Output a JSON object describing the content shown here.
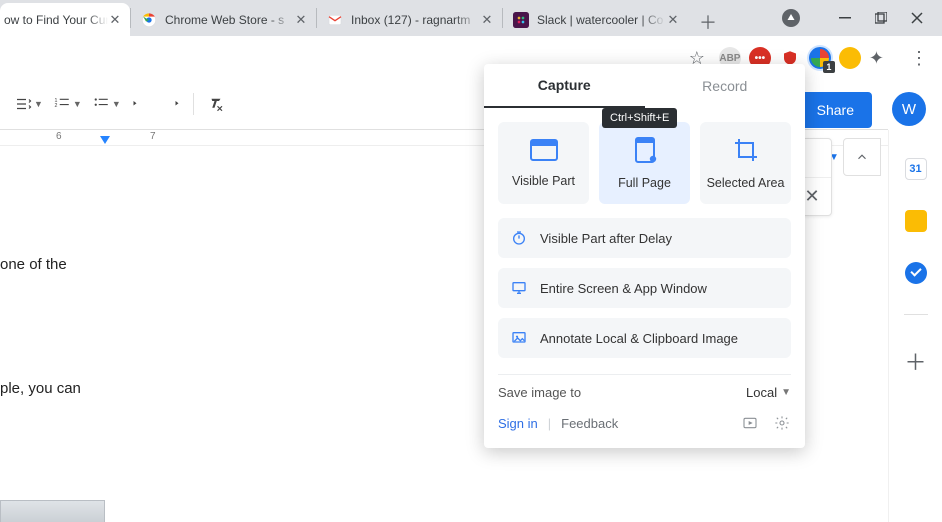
{
  "tabs": [
    {
      "label": "ow to Find Your Current"
    },
    {
      "label": "Chrome Web Store - s"
    },
    {
      "label": "Inbox (127) - ragnartm"
    },
    {
      "label": "Slack | watercooler | Co"
    }
  ],
  "extensions": {
    "abp": "ABP",
    "nimbus_badge": "1"
  },
  "docs": {
    "share": "Share",
    "avatar": "W",
    "ruler": {
      "n6": "6",
      "n7": "7"
    },
    "line1": "one of the",
    "line2": "ple, you can",
    "calendar_day": "31"
  },
  "popup": {
    "tab_capture": "Capture",
    "tab_record": "Record",
    "shortcut": "Ctrl+Shift+E",
    "cards": {
      "visible": "Visible Part",
      "full": "Full Page",
      "selected": "Selected Area"
    },
    "items": {
      "delay": "Visible Part after Delay",
      "screen": "Entire Screen & App Window",
      "annotate": "Annotate Local & Clipboard Image"
    },
    "save_label": "Save image to",
    "save_value": "Local",
    "signin": "Sign in",
    "feedback": "Feedback"
  }
}
